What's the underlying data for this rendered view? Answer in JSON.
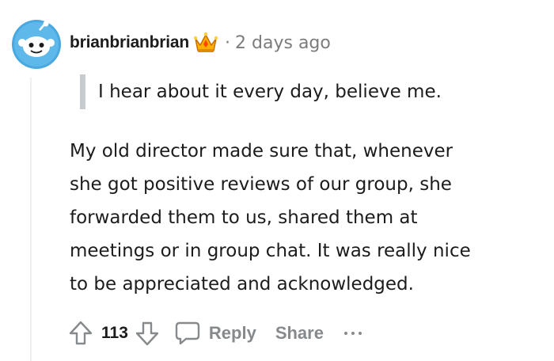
{
  "comment": {
    "author": "brianbrianbrian",
    "separator": "·",
    "time_ago": "2 days ago",
    "quote": "I hear about it every day, believe me.",
    "body_lines": [
      "My old director made sure that, whenever",
      "she got positive reviews of our group, she",
      "forwarded them to us, shared them at",
      "meetings or in group chat. It was really nice",
      "to be appreciated and acknowledged."
    ],
    "score": "113",
    "reply_label": "Reply",
    "share_label": "Share",
    "icons": {
      "avatar": "snoo-avatar",
      "award": "crown-award-icon",
      "upvote": "upvote-arrow-icon",
      "downvote": "downvote-arrow-icon",
      "reply": "speech-bubble-icon",
      "more": "ellipsis-icon"
    }
  },
  "colors": {
    "text": "#1c1c1c",
    "meta": "#7c7c7c",
    "action": "#878a8c",
    "avatar_bg": "#0dd3bb",
    "quote_bar": "#c8cbcd"
  }
}
